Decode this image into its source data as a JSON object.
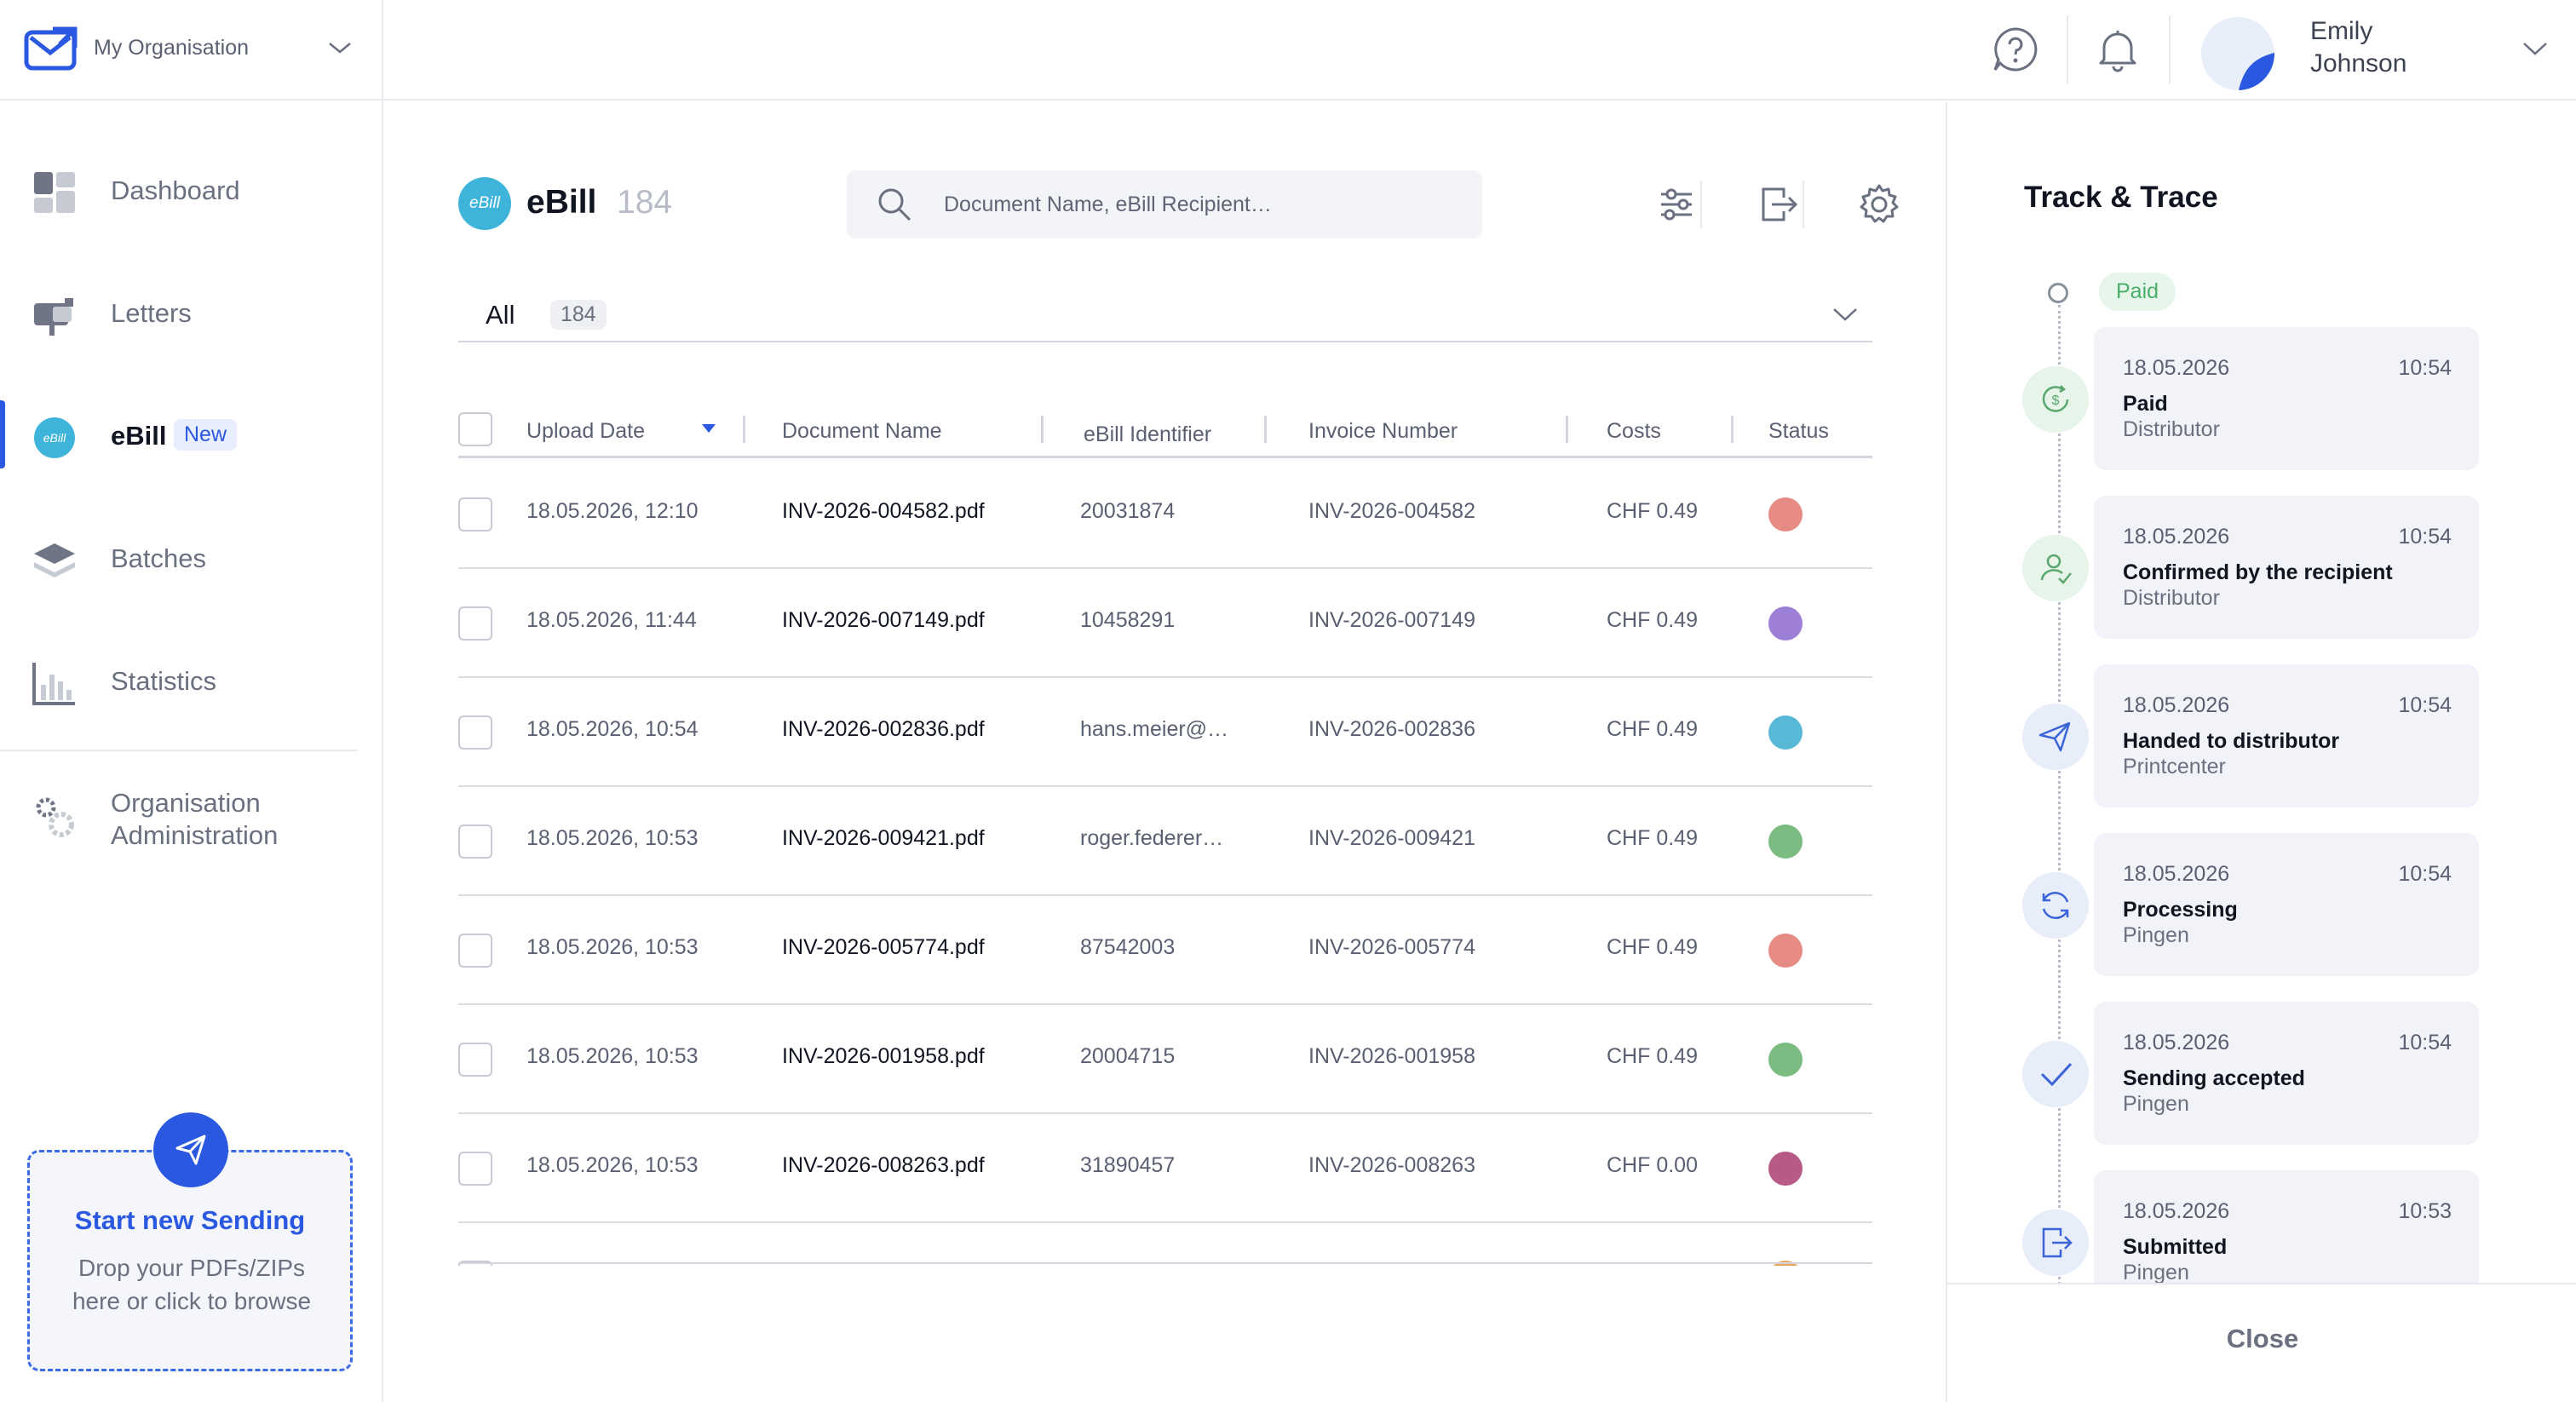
{
  "organisation": {
    "name": "My Organisation"
  },
  "sidebar": {
    "items": [
      {
        "label": "Dashboard",
        "icon": "dashboard-icon"
      },
      {
        "label": "Letters",
        "icon": "mailbox-icon"
      },
      {
        "label": "eBill",
        "icon": "ebill-icon",
        "badge": "New",
        "active": true
      },
      {
        "label": "Batches",
        "icon": "layers-icon"
      },
      {
        "label": "Statistics",
        "icon": "bar-chart-icon"
      }
    ],
    "admin": {
      "line1": "Organisation",
      "line2": "Administration",
      "icon": "gears-icon"
    },
    "upload": {
      "title": "Start new Sending",
      "subtitle": "Drop your PDFs/ZIPs here or click to browse",
      "icon": "send-icon"
    }
  },
  "header": {
    "user": {
      "first": "Emily",
      "last": "Johnson"
    },
    "icons": [
      "help-icon",
      "bell-icon"
    ]
  },
  "main": {
    "logo_text": "eBill",
    "title": "eBill",
    "count": "184",
    "search": {
      "placeholder": "Document Name, eBill Recipient…",
      "value": ""
    },
    "toolbar_icons": [
      "filter-sliders-icon",
      "export-icon",
      "settings-icon"
    ],
    "filter": {
      "label": "All",
      "count": "184"
    },
    "table": {
      "columns": [
        "Upload Date",
        "Document Name",
        "eBill Identifier",
        "Invoice Number",
        "Costs",
        "Status"
      ],
      "sort_column": "Upload Date",
      "rows": [
        {
          "date": "18.05.2026, 12:10",
          "doc": "INV-2026-004582.pdf",
          "id": "20031874",
          "invoice": "INV-2026-004582",
          "cost": "CHF 0.49",
          "status_color": "#e88b84"
        },
        {
          "date": "18.05.2026, 11:44",
          "doc": "INV-2026-007149.pdf",
          "id": "10458291",
          "invoice": "INV-2026-007149",
          "cost": "CHF 0.49",
          "status_color": "#9d7fd8"
        },
        {
          "date": "18.05.2026, 10:54",
          "doc": "INV-2026-002836.pdf",
          "id": "hans.meier@…",
          "invoice": "INV-2026-002836",
          "cost": "CHF 0.49",
          "status_color": "#58b8d6"
        },
        {
          "date": "18.05.2026, 10:53",
          "doc": "INV-2026-009421.pdf",
          "id": "roger.federer…",
          "invoice": "INV-2026-009421",
          "cost": "CHF 0.49",
          "status_color": "#7cbc82"
        },
        {
          "date": "18.05.2026, 10:53",
          "doc": "INV-2026-005774.pdf",
          "id": "87542003",
          "invoice": "INV-2026-005774",
          "cost": "CHF 0.49",
          "status_color": "#e88b84"
        },
        {
          "date": "18.05.2026, 10:53",
          "doc": "INV-2026-001958.pdf",
          "id": "20004715",
          "invoice": "INV-2026-001958",
          "cost": "CHF 0.49",
          "status_color": "#7cbc82"
        },
        {
          "date": "18.05.2026, 10:53",
          "doc": "INV-2026-008263.pdf",
          "id": "31890457",
          "invoice": "INV-2026-008263",
          "cost": "CHF 0.00",
          "status_color": "#b85a86"
        }
      ],
      "partial_row": {
        "status_color": "#e8a45a"
      }
    }
  },
  "track": {
    "title": "Track & Trace",
    "current_status": "Paid",
    "events": [
      {
        "date": "18.05.2026",
        "time": "10:54",
        "title": "Paid",
        "actor": "Distributor",
        "icon": "dollar-refresh-icon",
        "icon_bg": "#e6f4ea",
        "icon_color": "#5aa86e"
      },
      {
        "date": "18.05.2026",
        "time": "10:54",
        "title": "Confirmed by the recipient",
        "actor": "Distributor",
        "icon": "user-check-icon",
        "icon_bg": "#e6f4ea",
        "icon_color": "#5aa86e"
      },
      {
        "date": "18.05.2026",
        "time": "10:54",
        "title": "Handed to distributor",
        "actor": "Printcenter",
        "icon": "send-icon",
        "icon_bg": "#e8edfa",
        "icon_color": "#3a64d8"
      },
      {
        "date": "18.05.2026",
        "time": "10:54",
        "title": "Processing",
        "actor": "Pingen",
        "icon": "refresh-icon",
        "icon_bg": "#e8edfa",
        "icon_color": "#3a64d8"
      },
      {
        "date": "18.05.2026",
        "time": "10:54",
        "title": "Sending accepted",
        "actor": "Pingen",
        "icon": "check-icon",
        "icon_bg": "#e8edfa",
        "icon_color": "#3a64d8"
      },
      {
        "date": "18.05.2026",
        "time": "10:53",
        "title": "Submitted",
        "actor": "Pingen",
        "icon": "document-export-icon",
        "icon_bg": "#e8edfa",
        "icon_color": "#3a64d8"
      }
    ],
    "close_label": "Close"
  },
  "colors": {
    "accent": "#2b58e0",
    "ebill": "#3fb4da",
    "paid": "#4bae6a"
  }
}
